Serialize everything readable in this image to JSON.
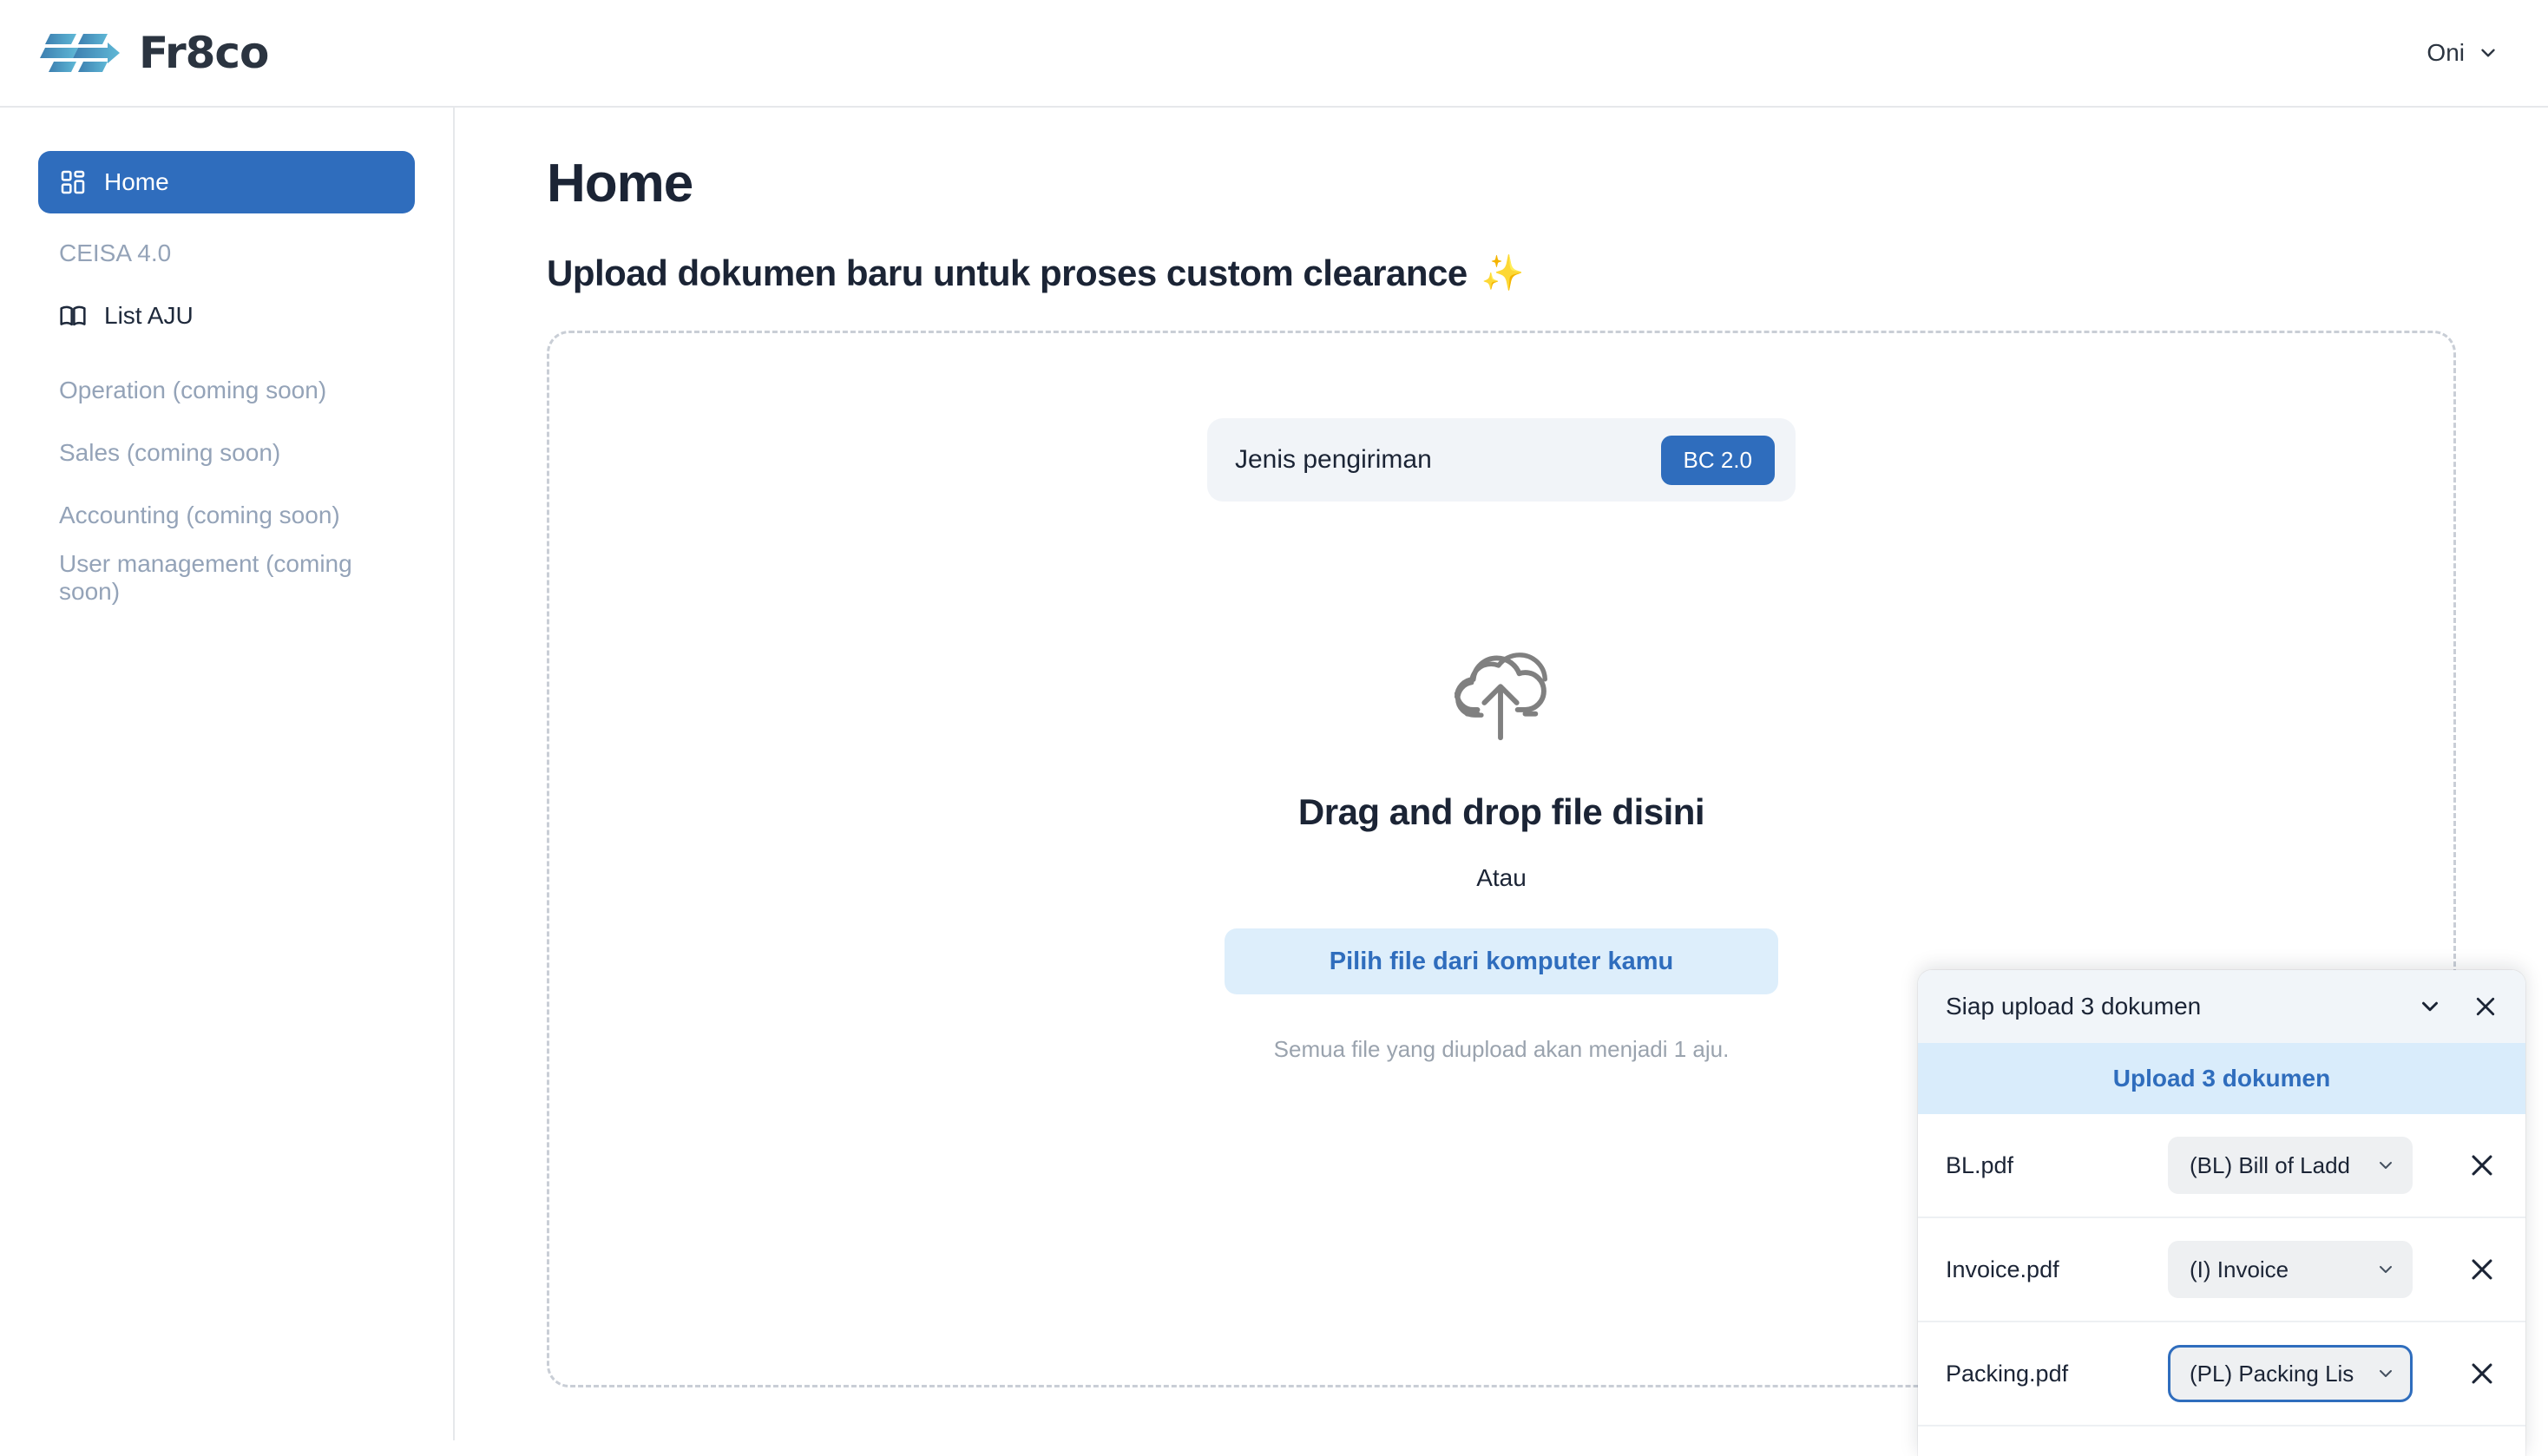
{
  "header": {
    "brand_name": "Fr8co",
    "logo_icon": "fr8co-logo-icon",
    "user_name": "Oni",
    "user_chevron_icon": "chevron-down-icon"
  },
  "sidebar": {
    "items": [
      {
        "label": "Home",
        "icon": "grid-dashboard-icon",
        "state": "active"
      },
      {
        "label": "CEISA 4.0",
        "icon": null,
        "state": "disabled"
      },
      {
        "label": "List AJU",
        "icon": "book-open-icon",
        "state": "enabled"
      },
      {
        "label": "Operation (coming soon)",
        "icon": null,
        "state": "disabled"
      },
      {
        "label": "Sales (coming soon)",
        "icon": null,
        "state": "disabled"
      },
      {
        "label": "Accounting (coming soon)",
        "icon": null,
        "state": "disabled"
      },
      {
        "label": "User management (coming soon)",
        "icon": null,
        "state": "disabled"
      }
    ]
  },
  "main": {
    "title": "Home",
    "subtitle": "Upload dokumen baru untuk proses custom clearance",
    "subtitle_emoji": "✨",
    "shipping": {
      "label": "Jenis pengiriman",
      "badge": "BC 2.0"
    },
    "dropzone": {
      "cloud_icon": "cloud-upload-icon",
      "title": "Drag and drop file disini",
      "or": "Atau",
      "pick_button": "Pilih file dari komputer kamu",
      "note": "Semua file yang diupload akan menjadi 1 aju."
    }
  },
  "upload_panel": {
    "title": "Siap upload 3 dokumen",
    "collapse_icon": "chevron-down-icon",
    "close_icon": "close-icon",
    "cta_label": "Upload 3 dokumen",
    "files": [
      {
        "name": "BL.pdf",
        "doc_type": "(BL) Bill of Ladd",
        "focused": false,
        "remove_icon": "close-icon"
      },
      {
        "name": "Invoice.pdf",
        "doc_type": "(I) Invoice",
        "focused": false,
        "remove_icon": "close-icon"
      },
      {
        "name": "Packing.pdf",
        "doc_type": "(PL) Packing Lis",
        "focused": true,
        "remove_icon": "close-icon"
      }
    ]
  },
  "colors": {
    "accent": "#2f6dbd",
    "accent_soft": "#d9ecfb",
    "panel_head": "#f1f5f9",
    "muted_text": "#94a3b8",
    "dark_text": "#1b2435"
  }
}
